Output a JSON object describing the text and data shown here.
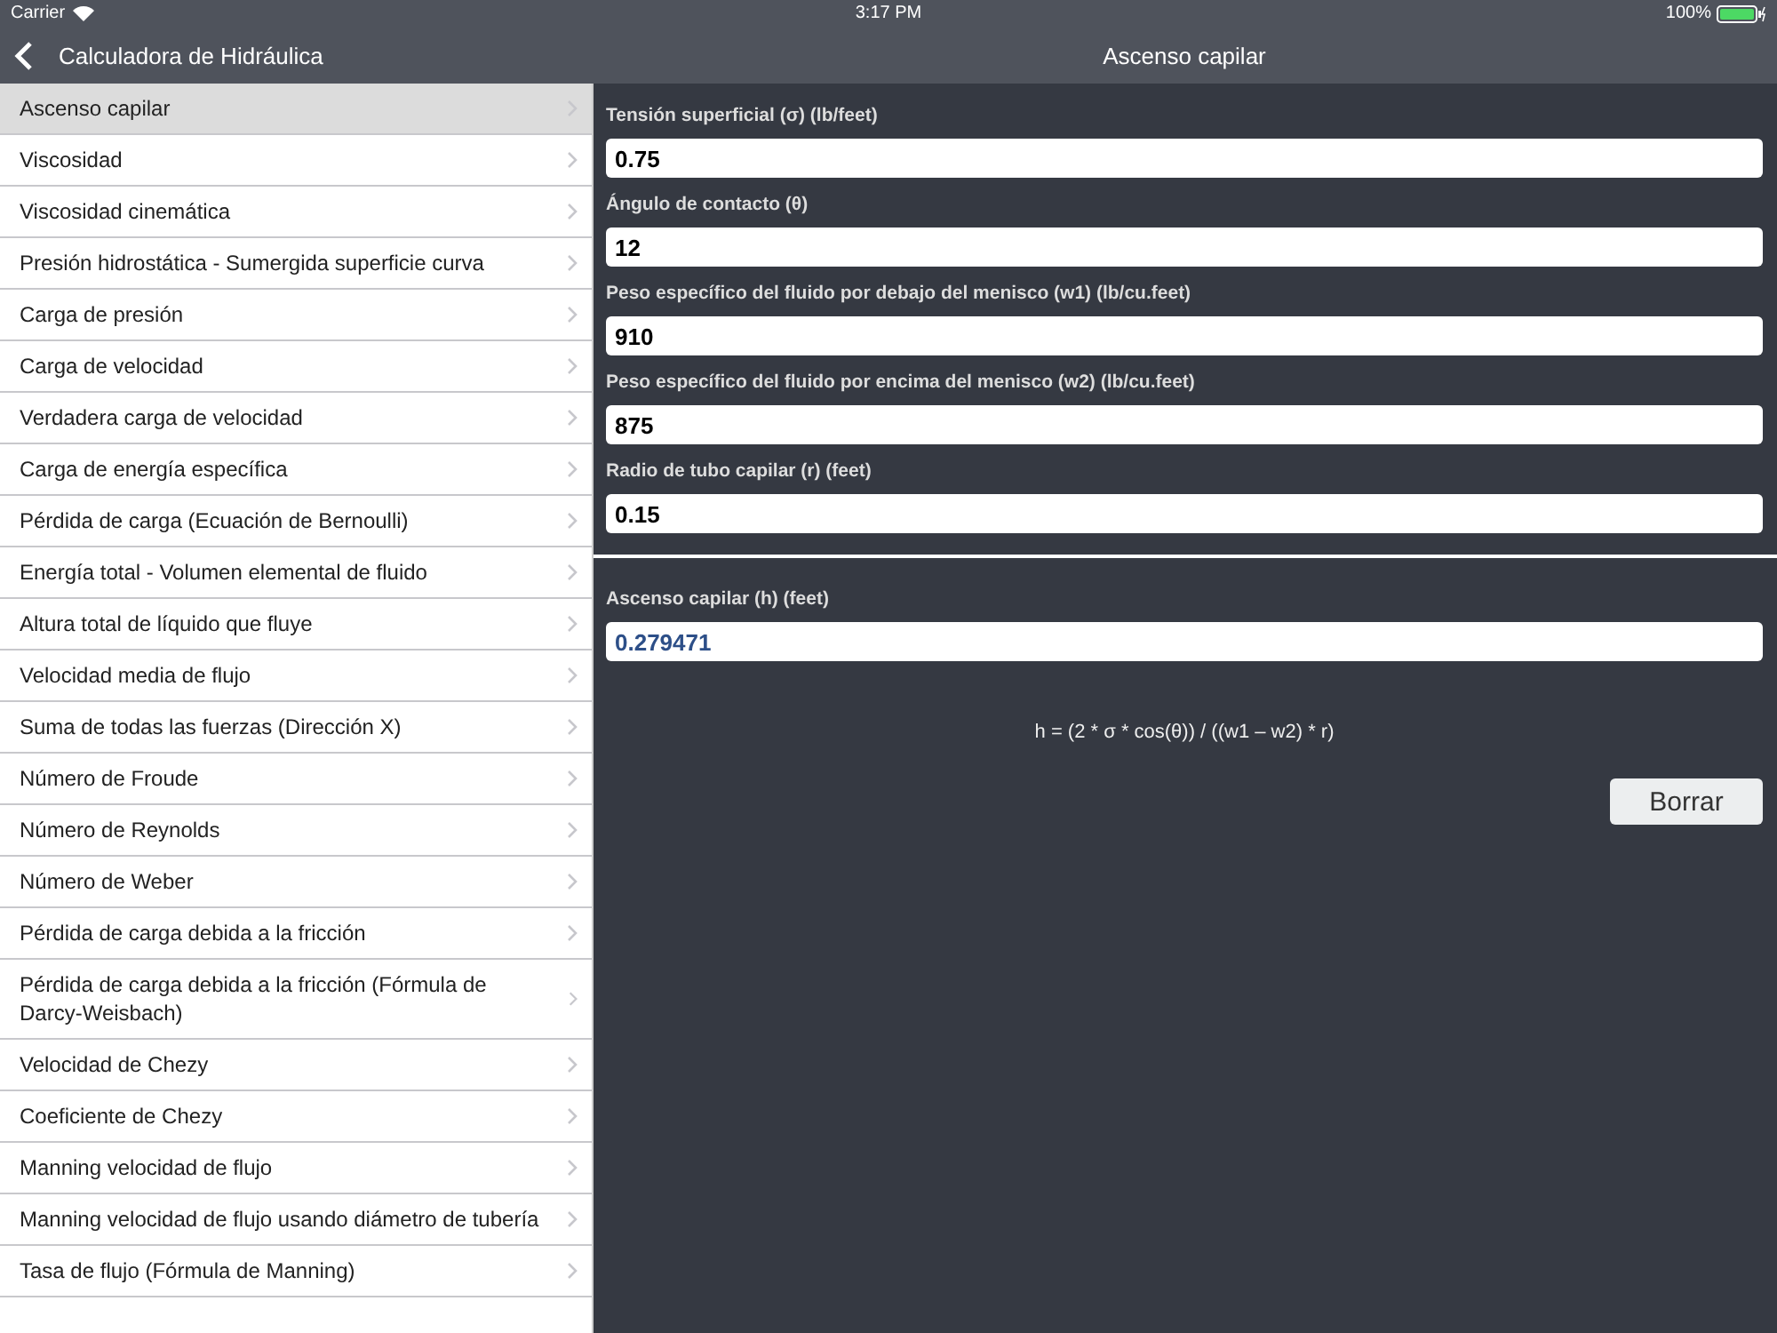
{
  "status_bar": {
    "carrier": "Carrier",
    "time": "3:17 PM",
    "battery": "100%"
  },
  "nav": {
    "back_title": "Calculadora de Hidráulica",
    "title": "Ascenso capilar"
  },
  "sidebar": {
    "items": [
      {
        "label": "Ascenso capilar",
        "selected": true
      },
      {
        "label": "Viscosidad",
        "selected": false
      },
      {
        "label": "Viscosidad cinemática",
        "selected": false
      },
      {
        "label": "Presión hidrostática - Sumergida superficie curva",
        "selected": false
      },
      {
        "label": "Carga de presión",
        "selected": false
      },
      {
        "label": "Carga de velocidad",
        "selected": false
      },
      {
        "label": "Verdadera carga de velocidad",
        "selected": false
      },
      {
        "label": "Carga de energía específica",
        "selected": false
      },
      {
        "label": "Pérdida de carga (Ecuación de Bernoulli)",
        "selected": false
      },
      {
        "label": "Energía total - Volumen elemental de fluido",
        "selected": false
      },
      {
        "label": "Altura total de líquido que fluye",
        "selected": false
      },
      {
        "label": "Velocidad media de flujo",
        "selected": false
      },
      {
        "label": "Suma de todas las fuerzas (Dirección X)",
        "selected": false
      },
      {
        "label": "Número de Froude",
        "selected": false
      },
      {
        "label": "Número de Reynolds",
        "selected": false
      },
      {
        "label": "Número de Weber",
        "selected": false
      },
      {
        "label": "Pérdida de carga debida a la fricción",
        "selected": false
      },
      {
        "label": "Pérdida de carga debida a la fricción (Fórmula de Darcy-Weisbach)",
        "selected": false
      },
      {
        "label": "Velocidad de Chezy",
        "selected": false
      },
      {
        "label": "Coeficiente de Chezy",
        "selected": false
      },
      {
        "label": "Manning velocidad de flujo",
        "selected": false
      },
      {
        "label": "Manning velocidad de flujo usando diámetro de tubería",
        "selected": false
      },
      {
        "label": "Tasa de flujo (Fórmula de Manning)",
        "selected": false
      }
    ]
  },
  "inputs": [
    {
      "label": "Tensión superficial (σ) (lb/feet)",
      "value": "0.75"
    },
    {
      "label": "Ángulo de contacto (θ)",
      "value": "12"
    },
    {
      "label": "Peso específico del fluido por debajo del menisco (w1) (lb/cu.feet)",
      "value": "910"
    },
    {
      "label": "Peso específico del fluido por encima del menisco (w2) (lb/cu.feet)",
      "value": "875"
    },
    {
      "label": "Radio de tubo capilar (r) (feet)",
      "value": "0.15"
    }
  ],
  "result": {
    "label": "Ascenso capilar (h) (feet)",
    "value": "0.279471"
  },
  "formula": "h = (2 * σ *  cos(θ)) / ((w1 – w2) * r)",
  "clear_button": "Borrar"
}
